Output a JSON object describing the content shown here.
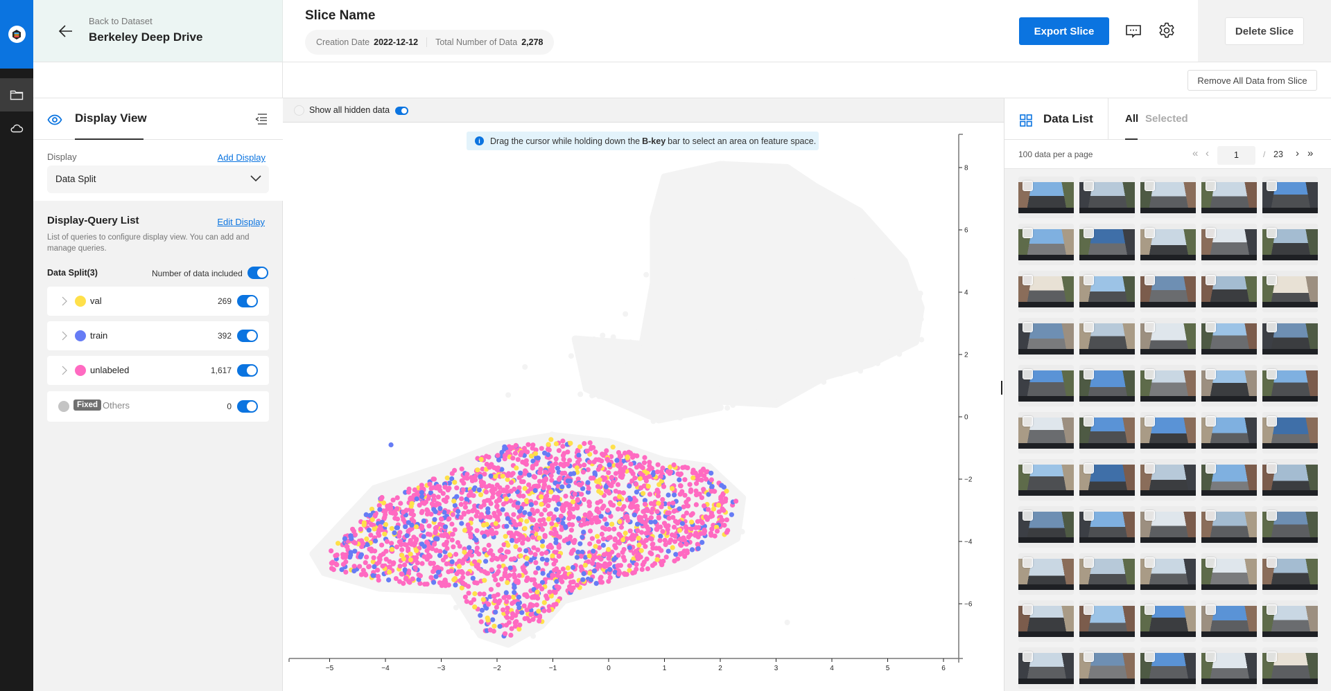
{
  "nav": {
    "items": [
      {
        "name": "logo",
        "icon": "app-logo-icon"
      },
      {
        "name": "datasets",
        "icon": "folder-icon",
        "active": true
      },
      {
        "name": "cloud",
        "icon": "cloud-icon",
        "active": false
      }
    ]
  },
  "back": {
    "sub_label": "Back to Dataset",
    "dataset_name": "Berkeley Deep Drive"
  },
  "header": {
    "slice_name": "Slice Name",
    "creation_date_label": "Creation Date",
    "creation_date": "2022-12-12",
    "total_label": "Total Number of Data",
    "total_value": "2,278",
    "export_label": "Export Slice",
    "delete_label": "Delete Slice",
    "remove_all_label": "Remove All Data from Slice"
  },
  "display_view": {
    "title": "Display View",
    "display_label": "Display",
    "add_display_label": "Add Display",
    "selected_display": "Data Split",
    "query_list_title": "Display-Query List",
    "edit_display_label": "Edit Display",
    "query_list_desc": "List of queries to configure display view. You can add and manage queries.",
    "split_title": "Data Split(3)",
    "count_toggle_label": "Number of data included",
    "count_toggle_on": true,
    "queries": [
      {
        "name": "val",
        "count": "269",
        "color": "#ffe04a",
        "enabled": true
      },
      {
        "name": "train",
        "count": "392",
        "color": "#667cf5",
        "enabled": true
      },
      {
        "name": "unlabeled",
        "count": "1,617",
        "color": "#ff6ac1",
        "enabled": true
      }
    ],
    "others": {
      "badge": "Fixed",
      "name": "Others",
      "count": "0",
      "color": "#c4c4c4",
      "enabled": true
    }
  },
  "plot": {
    "show_hidden_label": "Show all hidden data",
    "show_hidden_on": true,
    "info_pre": "Drag the cursor while holding down the",
    "info_key": "B-key",
    "info_post": "bar to select an area on feature space."
  },
  "chart_data": {
    "type": "scatter",
    "title": "",
    "xlabel": "",
    "ylabel": "",
    "xlim": [
      -5.7,
      6.2
    ],
    "ylim": [
      -7.7,
      9.1
    ],
    "x_ticks": [
      "-5",
      "-4",
      "-3",
      "-2",
      "-1",
      "0",
      "1",
      "2",
      "3",
      "4",
      "5",
      "6"
    ],
    "y_ticks": [
      "8",
      "6",
      "4",
      "2",
      "0",
      "-2",
      "-4",
      "-6"
    ],
    "y_axis_side": "right",
    "grid": false,
    "legend": "none",
    "series": [
      {
        "name": "val",
        "color": "#ffe04a",
        "count": 269,
        "region": "lower cluster x≈-5.2..2.3, y≈-7..-0.8"
      },
      {
        "name": "train",
        "color": "#667cf5",
        "count": 392,
        "region": "lower cluster x≈-5.2..2.3, y≈-7..-0.8"
      },
      {
        "name": "unlabeled",
        "color": "#ff6ac1",
        "count": 1617,
        "region": "lower cluster x≈-5.2..2.3, y≈-7..-0.8"
      },
      {
        "name": "hidden",
        "color": "#f2f2f2",
        "region": "upper cluster x≈0.8..5.6, y≈0.4..8.0 plus lower cluster background"
      }
    ]
  },
  "data_list": {
    "title": "Data List",
    "tabs": [
      {
        "label": "All",
        "active": true
      },
      {
        "label": "Selected",
        "active": false
      }
    ],
    "per_page_label": "100 data per a page",
    "current_page": "1",
    "total_pages": "23",
    "visible_thumbnail_rows": 11,
    "columns": 5
  }
}
